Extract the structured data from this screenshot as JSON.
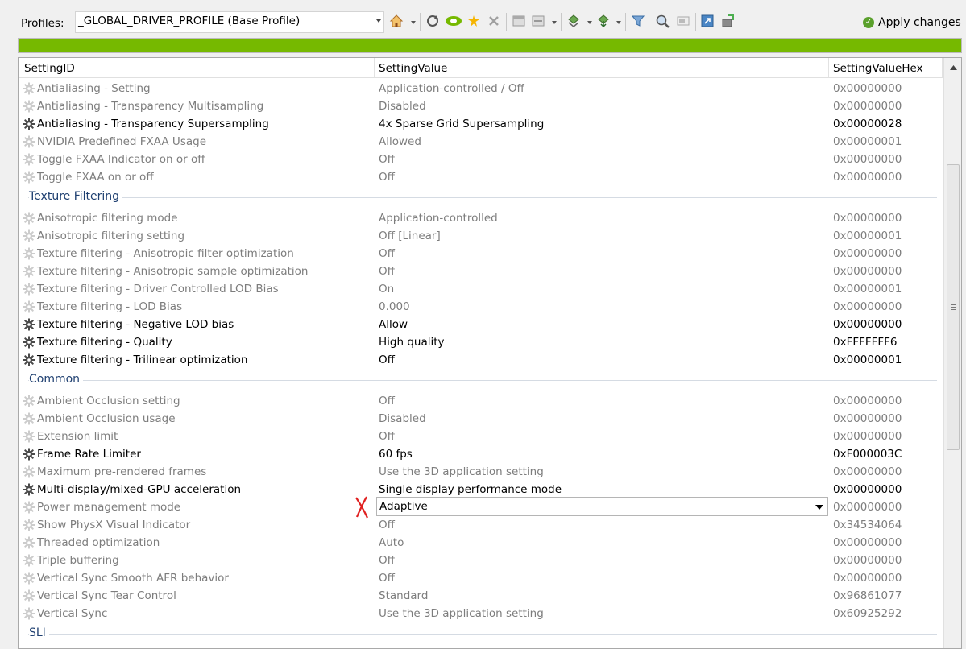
{
  "toolbar": {
    "profiles_label": "Profiles:",
    "profile_value": "_GLOBAL_DRIVER_PROFILE (Base Profile)",
    "apply_label": "Apply changes"
  },
  "progress": {
    "percent": 100,
    "color": "#76b900"
  },
  "columns": {
    "id": "SettingID",
    "value": "SettingValue",
    "hex": "SettingValueHex"
  },
  "rows": [
    {
      "id": "Antialiasing - Setting",
      "value": "Application-controlled / Off",
      "hex": "0x00000000",
      "modified": false
    },
    {
      "id": "Antialiasing - Transparency Multisampling",
      "value": "Disabled",
      "hex": "0x00000000",
      "modified": false
    },
    {
      "id": "Antialiasing - Transparency Supersampling",
      "value": "4x Sparse Grid Supersampling",
      "hex": "0x00000028",
      "modified": true
    },
    {
      "id": "NVIDIA Predefined FXAA Usage",
      "value": "Allowed",
      "hex": "0x00000001",
      "modified": false
    },
    {
      "id": "Toggle FXAA Indicator on or off",
      "value": "Off",
      "hex": "0x00000000",
      "modified": false
    },
    {
      "id": "Toggle FXAA on or off",
      "value": "Off",
      "hex": "0x00000000",
      "modified": false
    },
    {
      "group": "Texture Filtering"
    },
    {
      "id": "Anisotropic filtering mode",
      "value": "Application-controlled",
      "hex": "0x00000000",
      "modified": false
    },
    {
      "id": "Anisotropic filtering setting",
      "value": "Off [Linear]",
      "hex": "0x00000001",
      "modified": false
    },
    {
      "id": "Texture filtering - Anisotropic filter optimization",
      "value": "Off",
      "hex": "0x00000000",
      "modified": false
    },
    {
      "id": "Texture filtering - Anisotropic sample optimization",
      "value": "Off",
      "hex": "0x00000000",
      "modified": false
    },
    {
      "id": "Texture filtering - Driver Controlled LOD Bias",
      "value": "On",
      "hex": "0x00000001",
      "modified": false
    },
    {
      "id": "Texture filtering - LOD Bias",
      "value": "0.000",
      "hex": "0x00000000",
      "modified": false
    },
    {
      "id": "Texture filtering - Negative LOD bias",
      "value": "Allow",
      "hex": "0x00000000",
      "modified": true
    },
    {
      "id": "Texture filtering - Quality",
      "value": "High quality",
      "hex": "0xFFFFFFF6",
      "modified": true
    },
    {
      "id": "Texture filtering - Trilinear optimization",
      "value": "Off",
      "hex": "0x00000001",
      "modified": true
    },
    {
      "group": "Common"
    },
    {
      "id": "Ambient Occlusion setting",
      "value": "Off",
      "hex": "0x00000000",
      "modified": false
    },
    {
      "id": "Ambient Occlusion usage",
      "value": "Disabled",
      "hex": "0x00000000",
      "modified": false
    },
    {
      "id": "Extension limit",
      "value": "Off",
      "hex": "0x00000000",
      "modified": false
    },
    {
      "id": "Frame Rate Limiter",
      "value": "60 fps",
      "hex": "0xF000003C",
      "modified": true
    },
    {
      "id": "Maximum pre-rendered frames",
      "value": "Use the 3D application setting",
      "hex": "0x00000000",
      "modified": false
    },
    {
      "id": "Multi-display/mixed-GPU acceleration",
      "value": "Single display performance mode",
      "hex": "0x00000000",
      "modified": true
    },
    {
      "id": "Power management mode",
      "value": "Adaptive",
      "hex": "0x00000000",
      "modified": false,
      "editing": true
    },
    {
      "id": "Show PhysX Visual Indicator",
      "value": "Off",
      "hex": "0x34534064",
      "modified": false
    },
    {
      "id": "Threaded optimization",
      "value": "Auto",
      "hex": "0x00000000",
      "modified": false
    },
    {
      "id": "Triple buffering",
      "value": "Off",
      "hex": "0x00000000",
      "modified": false
    },
    {
      "id": "Vertical Sync Smooth AFR behavior",
      "value": "Off",
      "hex": "0x00000000",
      "modified": false
    },
    {
      "id": "Vertical Sync Tear Control",
      "value": "Standard",
      "hex": "0x96861077",
      "modified": false
    },
    {
      "id": "Vertical Sync",
      "value": "Use the 3D application setting",
      "hex": "0x60925292",
      "modified": false
    },
    {
      "group": "SLI"
    }
  ]
}
